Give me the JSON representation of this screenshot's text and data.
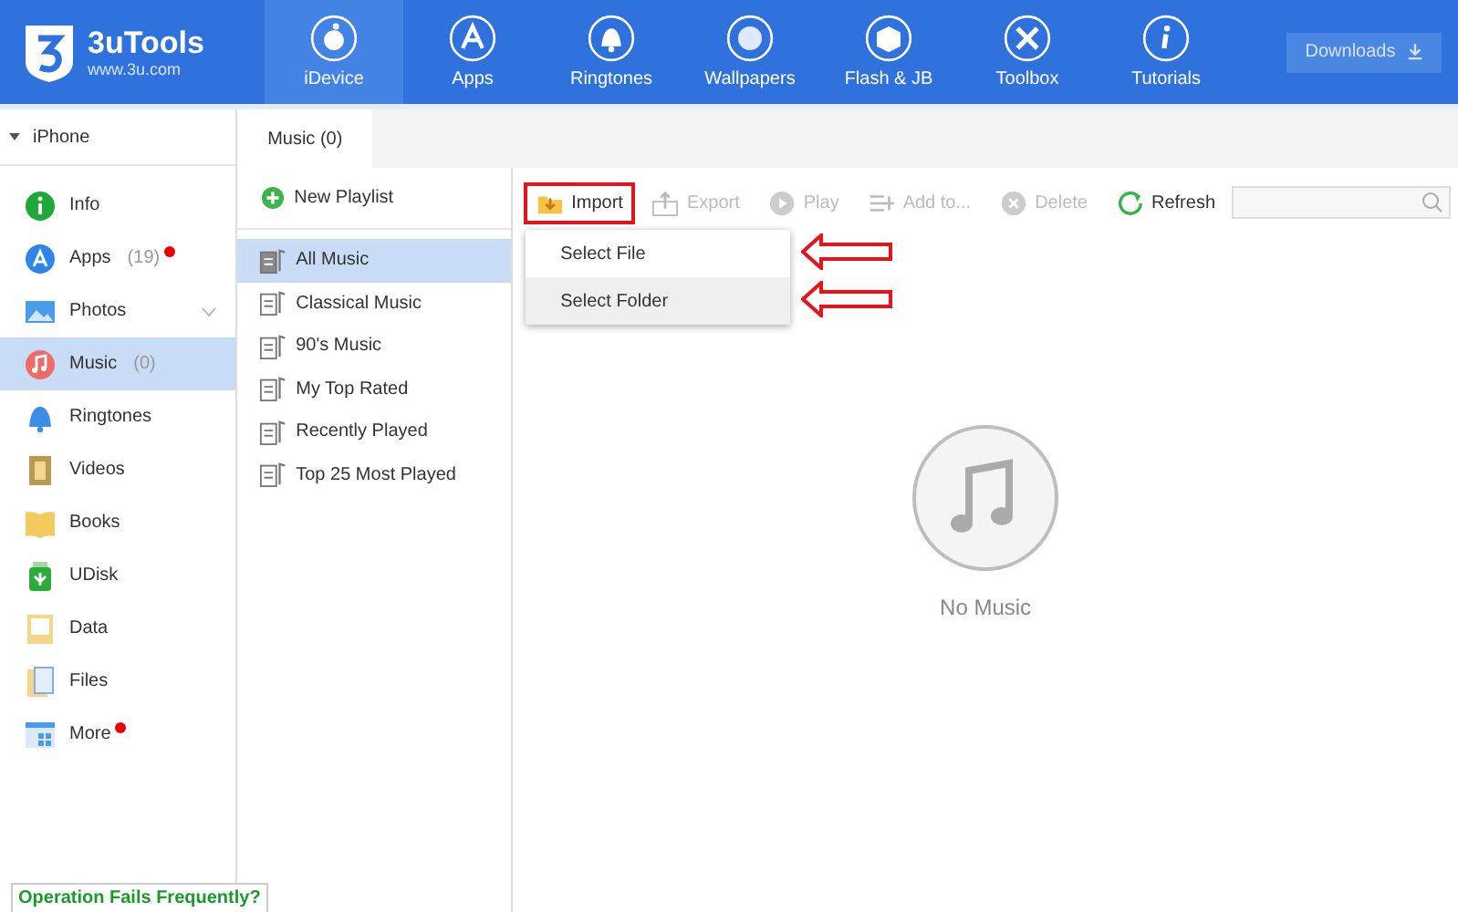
{
  "header": {
    "logo_title": "3uTools",
    "logo_subtitle": "www.3u.com",
    "nav": [
      {
        "label": "iDevice",
        "selected": true
      },
      {
        "label": "Apps",
        "selected": false
      },
      {
        "label": "Ringtones",
        "selected": false
      },
      {
        "label": "Wallpapers",
        "selected": false
      },
      {
        "label": "Flash & JB",
        "selected": false
      },
      {
        "label": "Toolbox",
        "selected": false
      },
      {
        "label": "Tutorials",
        "selected": false
      }
    ],
    "downloads_button": "Downloads"
  },
  "sidebar": {
    "device": "iPhone",
    "expanded": true,
    "items": [
      {
        "label": "Info",
        "selected": false,
        "dot": false,
        "expandable": false
      },
      {
        "label": "Apps",
        "count": "(19)",
        "selected": false,
        "dot": true,
        "expandable": false
      },
      {
        "label": "Photos",
        "selected": false,
        "dot": false,
        "expandable": true
      },
      {
        "label": "Music",
        "count": "(0)",
        "selected": true,
        "dot": false,
        "expandable": false
      },
      {
        "label": "Ringtones",
        "selected": false,
        "dot": false,
        "expandable": false
      },
      {
        "label": "Videos",
        "selected": false,
        "dot": false,
        "expandable": false
      },
      {
        "label": "Books",
        "selected": false,
        "dot": false,
        "expandable": false
      },
      {
        "label": "UDisk",
        "selected": false,
        "dot": false,
        "expandable": false
      },
      {
        "label": "Data",
        "selected": false,
        "dot": false,
        "expandable": false
      },
      {
        "label": "Files",
        "selected": false,
        "dot": false,
        "expandable": false
      },
      {
        "label": "More",
        "selected": false,
        "dot": true,
        "expandable": false
      }
    ],
    "help_link": "Operation Fails Frequently?"
  },
  "tabs": [
    {
      "label": "Music (0)",
      "selected": true
    }
  ],
  "new_playlist": "New Playlist",
  "playlists": [
    {
      "label": "All Music",
      "selected": true
    },
    {
      "label": "Classical Music",
      "selected": false
    },
    {
      "label": "90's Music",
      "selected": false
    },
    {
      "label": "My Top Rated",
      "selected": false
    },
    {
      "label": "Recently Played",
      "selected": false
    },
    {
      "label": "Top 25 Most Played",
      "selected": false
    }
  ],
  "toolbar": [
    {
      "label": "Import",
      "disabled": false,
      "highlighted": true
    },
    {
      "label": "Export",
      "disabled": true,
      "highlighted": false
    },
    {
      "label": "Play",
      "disabled": true,
      "highlighted": false
    },
    {
      "label": "Add to...",
      "disabled": true,
      "highlighted": false
    },
    {
      "label": "Delete",
      "disabled": true,
      "highlighted": false
    },
    {
      "label": "Refresh",
      "disabled": false,
      "highlighted": false
    }
  ],
  "import_menu": [
    {
      "label": "Select File",
      "selected": false
    },
    {
      "label": "Select Folder",
      "selected": true
    }
  ],
  "empty_state": "No Music"
}
